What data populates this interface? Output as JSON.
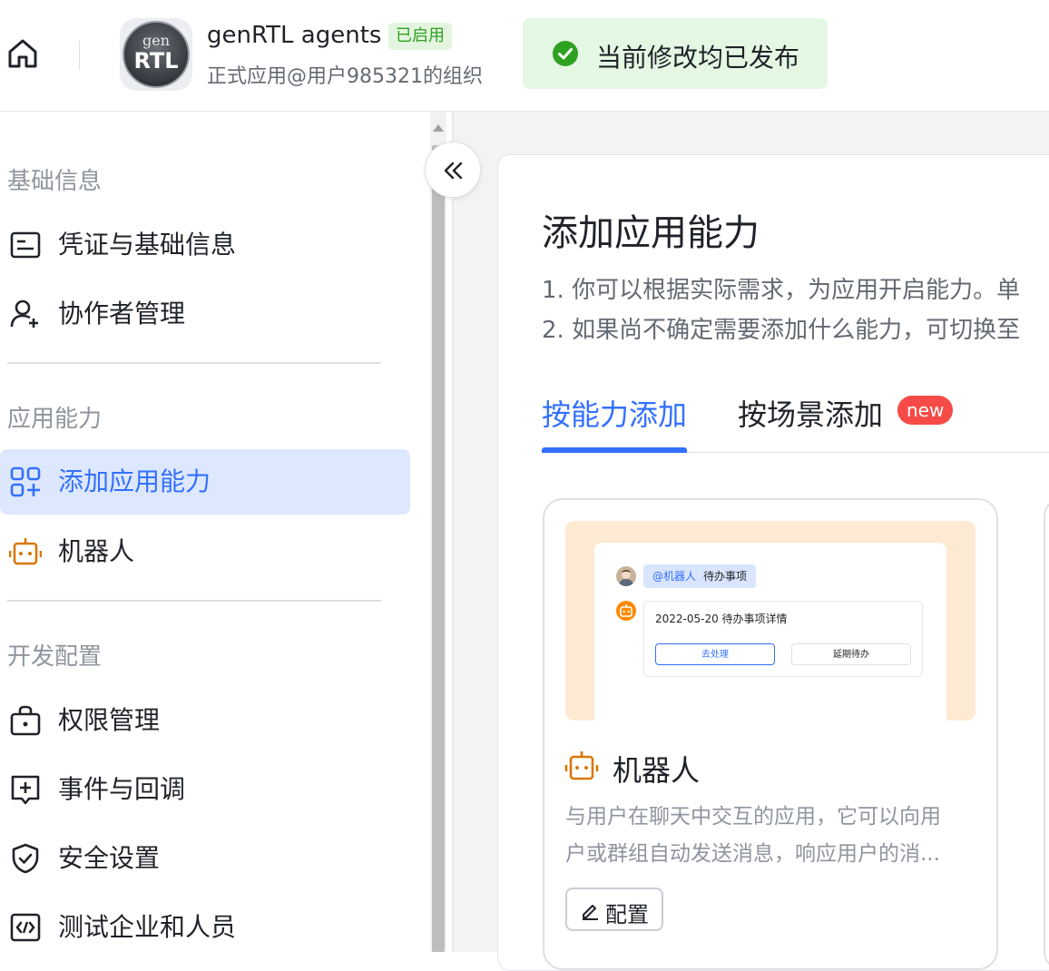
{
  "header": {
    "app_name": "genRTL agents",
    "status": "已启用",
    "org": "正式应用@用户985321的组织",
    "logo_text_top": "gen",
    "logo_text_main": "RTL",
    "toast": "当前修改均已发布"
  },
  "sidebar": {
    "groups": [
      {
        "title": "基础信息",
        "items": [
          {
            "label": "凭证与基础信息",
            "icon": "credential-icon"
          },
          {
            "label": "协作者管理",
            "icon": "user-add-icon"
          }
        ]
      },
      {
        "title": "应用能力",
        "items": [
          {
            "label": "添加应用能力",
            "icon": "add-apps-icon",
            "active": true
          },
          {
            "label": "机器人",
            "icon": "robot-icon"
          }
        ]
      },
      {
        "title": "开发配置",
        "items": [
          {
            "label": "权限管理",
            "icon": "permission-icon"
          },
          {
            "label": "事件与回调",
            "icon": "event-icon"
          },
          {
            "label": "安全设置",
            "icon": "shield-icon"
          },
          {
            "label": "测试企业和人员",
            "icon": "code-icon"
          }
        ]
      }
    ]
  },
  "main": {
    "title": "添加应用能力",
    "desc_lines": [
      "1. 你可以根据实际需求，为应用开启能力。单",
      "2. 如果尚不确定需要添加什么能力，可切换至"
    ],
    "tabs": [
      {
        "label": "按能力添加",
        "active": true
      },
      {
        "label": "按场景添加",
        "badge": "new"
      }
    ],
    "card": {
      "preview": {
        "mention": "@机器人",
        "mention_text": "待办事项",
        "box_title": "2022-05-20 待办事项详情",
        "btn_primary": "去处理",
        "btn_secondary": "延期待办"
      },
      "title": "机器人",
      "desc_lines": [
        "与用户在聊天中交互的应用，它可以向用",
        "户或群组自动发送消息，响应用户的消..."
      ],
      "config_label": "配置"
    }
  },
  "colors": {
    "accent": "#3370ff",
    "active_bg": "#dde7fd",
    "success": "#2ea121",
    "toast_bg": "#e4f7e3",
    "badge": "#f54a45",
    "robot": "#d97706"
  }
}
